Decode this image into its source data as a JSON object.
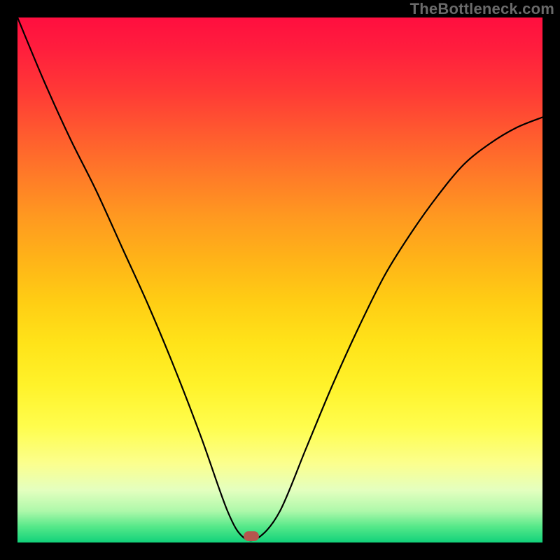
{
  "watermark": "TheBottleneck.com",
  "marker": {
    "cx_frac": 0.445,
    "cy_frac": 0.988,
    "color": "#b5564e"
  },
  "chart_data": {
    "type": "line",
    "title": "",
    "xlabel": "",
    "ylabel": "",
    "xlim": [
      0,
      1
    ],
    "ylim": [
      0,
      1
    ],
    "series": [
      {
        "name": "bottleneck-curve",
        "x": [
          0.0,
          0.05,
          0.1,
          0.15,
          0.2,
          0.25,
          0.3,
          0.35,
          0.4,
          0.43,
          0.46,
          0.5,
          0.55,
          0.6,
          0.65,
          0.7,
          0.75,
          0.8,
          0.85,
          0.9,
          0.95,
          1.0
        ],
        "y": [
          1.0,
          0.88,
          0.77,
          0.67,
          0.56,
          0.45,
          0.33,
          0.2,
          0.06,
          0.01,
          0.01,
          0.06,
          0.18,
          0.3,
          0.41,
          0.51,
          0.59,
          0.66,
          0.72,
          0.76,
          0.79,
          0.81
        ]
      }
    ],
    "grid": false,
    "background_gradient": {
      "top": "#ff0e3f",
      "mid": "#ffe319",
      "bottom": "#11d27a"
    }
  }
}
